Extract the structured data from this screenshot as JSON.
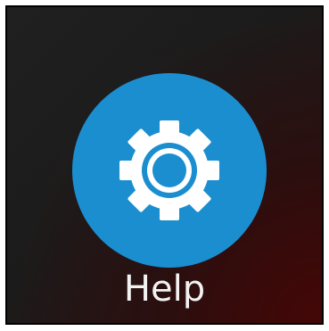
{
  "app_tile": {
    "label": "Help",
    "icon": "gear-icon",
    "colors": {
      "icon_background": "#1b8ed0",
      "icon_foreground": "#ffffff",
      "label_color": "#f2f2f2",
      "tile_background": "#1e1e1e",
      "tile_accent": "#460606"
    }
  }
}
